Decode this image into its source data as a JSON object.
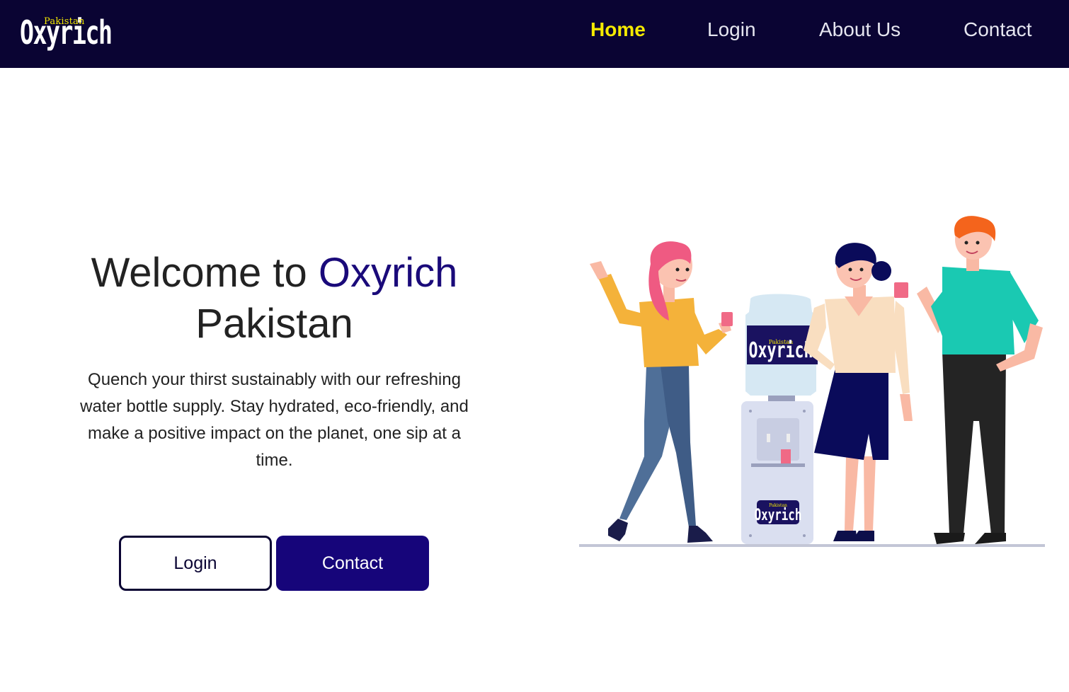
{
  "navbar": {
    "logo": {
      "small_text": "Pakistan",
      "main_text": "Oxyrich"
    },
    "links": [
      {
        "label": "Home",
        "active": true
      },
      {
        "label": "Login",
        "active": false
      },
      {
        "label": "About Us",
        "active": false
      },
      {
        "label": "Contact",
        "active": false
      }
    ]
  },
  "hero": {
    "title_prefix": "Welcome to",
    "title_brand": "Oxyrich",
    "title_suffix": "Pakistan",
    "description": "Quench your thirst sustainably with our refreshing water bottle supply. Stay hydrated, eco-friendly, and make a positive impact on the planet, one sip at a time.",
    "buttons": {
      "login_label": "Login",
      "contact_label": "Contact"
    }
  },
  "illustration": {
    "bottle_label": {
      "small_text": "Pakistan",
      "main_text": "Oxyrich"
    },
    "dispenser_label": {
      "small_text": "Pakistan",
      "main_text": "Oxyrich"
    }
  },
  "colors": {
    "navbar_bg": "#0a0433",
    "active_link": "#f5ea00",
    "brand": "#1a0a7a",
    "primary_button": "#16057a"
  }
}
